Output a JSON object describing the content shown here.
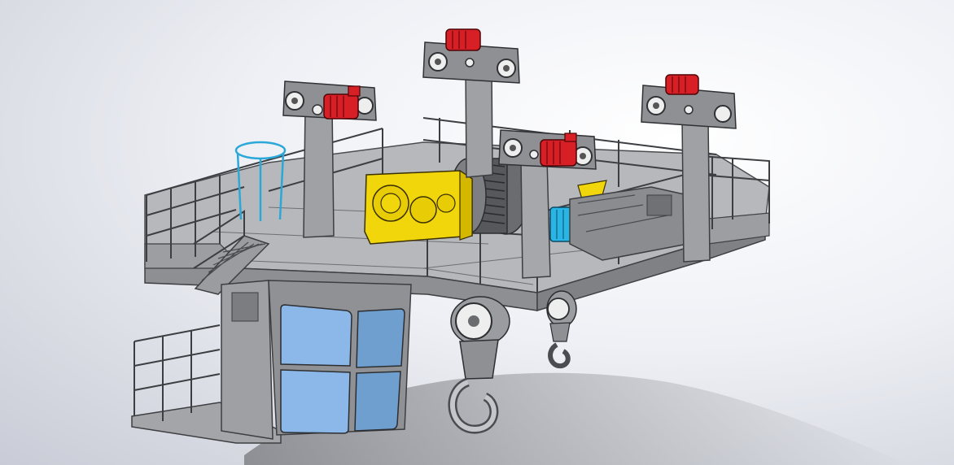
{
  "scene": {
    "colors": {
      "background_light": "#ffffff",
      "background_dark": "#c9ccd6",
      "steel": "#a9abae",
      "steel_dark": "#5f6164",
      "gearbox": "#f2d60c",
      "motor": "#d91f26",
      "drive_motor": "#29b6e6",
      "cabin_glass": "#8bb8e8",
      "ladder_rail": "#2aa8d8"
    },
    "icons": [
      "overhead-crane-trolley-model"
    ]
  }
}
